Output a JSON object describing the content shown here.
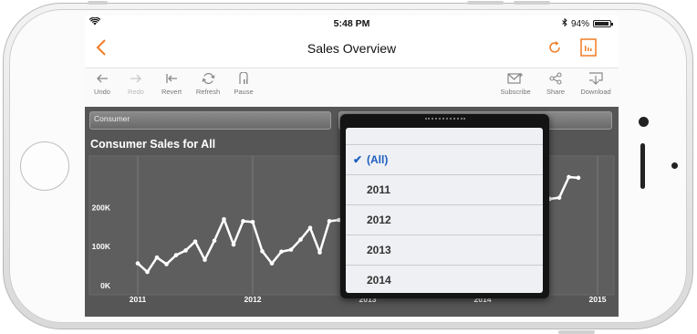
{
  "status_bar": {
    "time": "5:48 PM",
    "battery": "94%",
    "battery_level": 0.94
  },
  "nav": {
    "title": "Sales Overview"
  },
  "toolbar": {
    "undo": "Undo",
    "redo": "Redo",
    "revert": "Revert",
    "refresh": "Refresh",
    "pause": "Pause",
    "subscribe": "Subscribe",
    "share": "Share",
    "download": "Download"
  },
  "filters": {
    "segment": "Consumer",
    "year": ""
  },
  "chart_title": "Consumer Sales for All",
  "year_popover": {
    "options": [
      "(All)",
      "2011",
      "2012",
      "2013",
      "2014"
    ],
    "selected": "(All)"
  },
  "colors": {
    "accent": "#f07c23",
    "chart_bg": "#565656",
    "line": "#ffffff",
    "selected": "#1f5fbf"
  },
  "chart_data": {
    "type": "line",
    "title": "Consumer Sales for All",
    "x_ticks": [
      "2011",
      "2012",
      "2013",
      "2014",
      "2015"
    ],
    "y_ticks": [
      "0K",
      "100K",
      "200K"
    ],
    "ylim": [
      0,
      320000
    ],
    "grid": "vertical",
    "series": [
      {
        "values_first": [
          57000,
          35000,
          72000,
          55000,
          78000,
          90000,
          113000,
          66000,
          115000,
          170000,
          105000,
          165000,
          163000,
          88000,
          57000,
          87000,
          92000,
          118000,
          148000,
          85000,
          165000,
          168000
        ],
        "values_last": [
          225000,
          222000,
          225000,
          278000,
          276000
        ]
      }
    ]
  }
}
